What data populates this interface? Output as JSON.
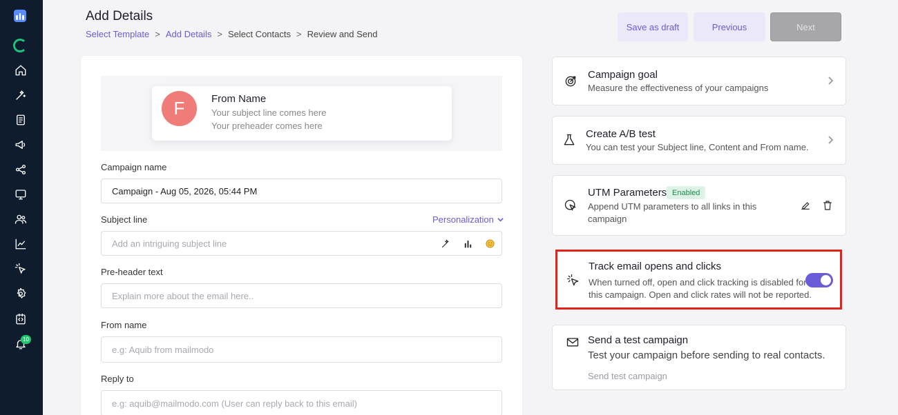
{
  "header": {
    "title": "Add Details",
    "breadcrumb": [
      {
        "label": "Select Template"
      },
      {
        "label": "Add Details"
      },
      {
        "label": "Select Contacts"
      },
      {
        "label": "Review and Send"
      }
    ],
    "separator": ">",
    "buttons": {
      "save_draft": "Save as draft",
      "previous": "Previous",
      "next": "Next"
    }
  },
  "sidebar": {
    "icons": [
      "logo-icon",
      "loading-icon",
      "home-icon",
      "magic-wand-icon",
      "document-icon",
      "megaphone-icon",
      "share-icon",
      "monitor-icon",
      "users-icon",
      "chart-icon",
      "cursor-click-icon",
      "settings-icon",
      "code-icon",
      "bell-icon"
    ],
    "notification_count": "10"
  },
  "preview": {
    "avatar_letter": "F",
    "from_name": "From Name",
    "subject": "Your subject line comes here",
    "preheader": "Your preheader comes here"
  },
  "form": {
    "campaign_name": {
      "label": "Campaign name",
      "value": "Campaign - Aug 05, 2026, 05:44 PM"
    },
    "subject_line": {
      "label": "Subject line",
      "placeholder": "Add an intriguing subject line",
      "personalization": "Personalization"
    },
    "preheader": {
      "label": "Pre-header text",
      "placeholder": "Explain more about the email here.."
    },
    "from_name": {
      "label": "From name",
      "placeholder": "e.g: Aquib from mailmodo"
    },
    "reply_to": {
      "label": "Reply to",
      "placeholder": "e.g: aquib@mailmodo.com (User can reply back to this email)"
    }
  },
  "cards": {
    "goal": {
      "title": "Campaign goal",
      "desc": "Measure the effectiveness of your campaigns"
    },
    "ab_test": {
      "title": "Create A/B test",
      "desc": "You can test your Subject line, Content and From name."
    },
    "utm": {
      "title": "UTM Parameters",
      "badge": "Enabled",
      "desc_line1": "Append UTM parameters to all links in this",
      "desc_line2": "campaign"
    },
    "tracking": {
      "title": "Track email opens and clicks",
      "desc_line1": "When turned off, open and click tracking is disabled for",
      "desc_line2": "this campaign. Open and click rates will not be reported.",
      "enabled": true
    },
    "test_campaign": {
      "title": "Send a test campaign",
      "desc": "Test your campaign before sending to real contacts.",
      "link": "Send test campaign"
    }
  },
  "colors": {
    "accent": "#6a5bd6",
    "sidebar": "#0f1c2e",
    "highlight": "#e2231a",
    "badge_bg": "#dcf3e6"
  }
}
